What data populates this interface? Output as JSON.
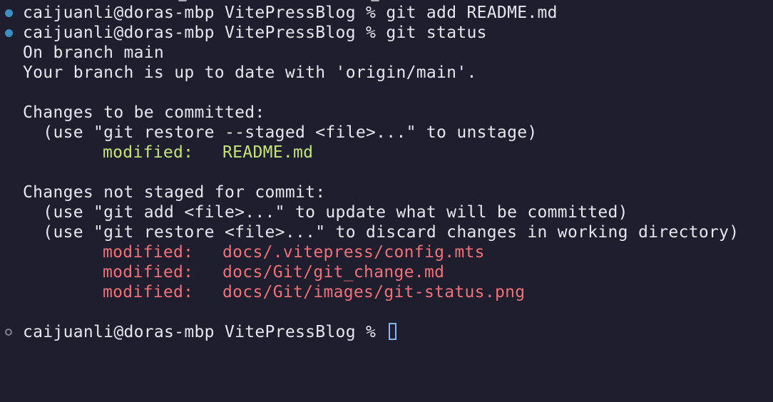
{
  "terminal": {
    "colors": {
      "background": "#1e1e2e",
      "text": "#e6e6ee",
      "success_marker": "#3d8fc1",
      "staged": "#c5e478",
      "unstaged": "#f07178",
      "cursor": "#8ab4f8"
    },
    "commands": [
      {
        "prompt": "caijuanli@doras-mbp VitePressBlog % ",
        "command": "git add README.md",
        "status": "success"
      },
      {
        "prompt": "caijuanli@doras-mbp VitePressBlog % ",
        "command": "git status",
        "status": "success"
      }
    ],
    "output": {
      "branch_line": "On branch main",
      "upstream_line": "Your branch is up to date with 'origin/main'.",
      "staged_header": "Changes to be committed:",
      "staged_hint": "  (use \"git restore --staged <file>...\" to unstage)",
      "staged_files": [
        {
          "status": "modified:",
          "path": "README.md"
        }
      ],
      "unstaged_header": "Changes not staged for commit:",
      "unstaged_hint_1": "  (use \"git add <file>...\" to update what will be committed)",
      "unstaged_hint_2": "  (use \"git restore <file>...\" to discard changes in working directory)",
      "unstaged_files": [
        {
          "status": "modified:",
          "path": "docs/.vitepress/config.mts"
        },
        {
          "status": "modified:",
          "path": "docs/Git/git_change.md"
        },
        {
          "status": "modified:",
          "path": "docs/Git/images/git-status.png"
        }
      ]
    },
    "current_prompt": "caijuanli@doras-mbp VitePressBlog % "
  }
}
